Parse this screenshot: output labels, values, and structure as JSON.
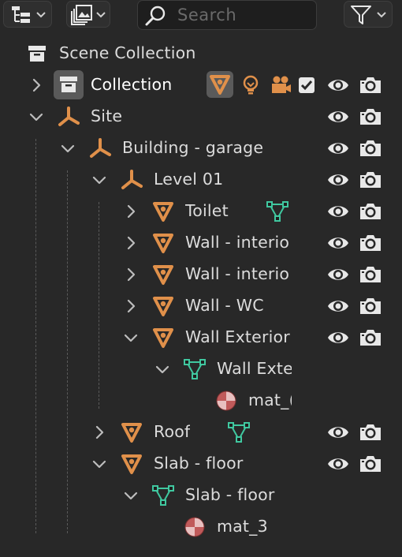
{
  "search": {
    "placeholder": "Search"
  },
  "toolbar": {
    "display_mode_icon": "outliner-display-mode-icon",
    "filter_view_icon": "image-layers-icon",
    "filter_icon": "funnel-icon"
  },
  "colors": {
    "background": "#282828",
    "object_orange": "#e0904a",
    "mesh_green": "#40c8a0",
    "material_red": "#c05a5a",
    "text": "#dcdcdc"
  },
  "tree": {
    "scene_collection": "Scene Collection",
    "collection": "Collection",
    "site": "Site",
    "building": "Building - garage",
    "level": "Level 01",
    "toilet": "Toilet",
    "wall_interior_1": "Wall - interio",
    "wall_interior_2": "Wall - interio",
    "wall_wc": "Wall - WC",
    "wall_exterior": "Wall Exterior",
    "wall_exterior_mesh": "Wall Exte",
    "mat_partial": "mat_(",
    "roof": "Roof",
    "slab": "Slab - floor",
    "slab_mesh": "Slab - floor",
    "mat_3": "mat_3"
  }
}
